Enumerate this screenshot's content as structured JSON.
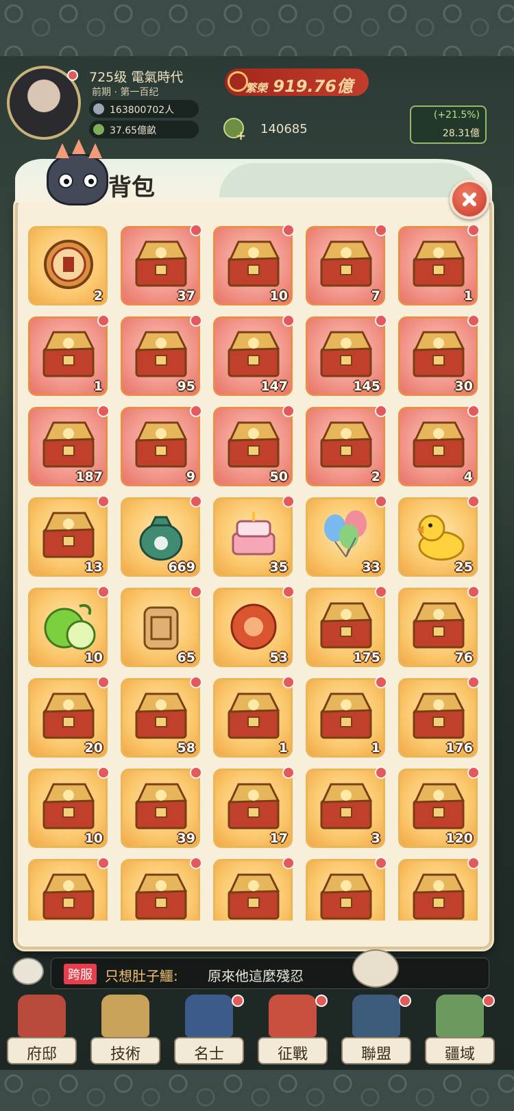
{
  "header": {
    "level": "725级",
    "era": "電氣時代",
    "period": "前期 · 第一百纪",
    "population": "163800702人",
    "land": "37.65億畝",
    "prosperity_label": "繁榮",
    "prosperity_value": "919.76億",
    "gold": "140685",
    "growth_pct": "(+21.5%)",
    "growth_amount": "28.31億"
  },
  "bag": {
    "title": "背包",
    "close_icon": "close-icon",
    "items": [
      {
        "qty": "2",
        "bg": "gold",
        "kind": "coin-token",
        "dot": false
      },
      {
        "qty": "37",
        "bg": "red",
        "kind": "chest",
        "dot": true
      },
      {
        "qty": "10",
        "bg": "red",
        "kind": "chest",
        "dot": true
      },
      {
        "qty": "7",
        "bg": "red",
        "kind": "chest",
        "dot": true
      },
      {
        "qty": "1",
        "bg": "red",
        "kind": "chest",
        "dot": true
      },
      {
        "qty": "1",
        "bg": "red",
        "kind": "chest",
        "dot": true
      },
      {
        "qty": "95",
        "bg": "red",
        "kind": "chest",
        "dot": true
      },
      {
        "qty": "147",
        "bg": "red",
        "kind": "chest",
        "dot": true
      },
      {
        "qty": "145",
        "bg": "red",
        "kind": "chest",
        "dot": true
      },
      {
        "qty": "30",
        "bg": "red",
        "kind": "chest",
        "dot": true
      },
      {
        "qty": "187",
        "bg": "red",
        "kind": "chest",
        "dot": true
      },
      {
        "qty": "9",
        "bg": "red",
        "kind": "chest",
        "dot": true
      },
      {
        "qty": "50",
        "bg": "red",
        "kind": "chest",
        "dot": true
      },
      {
        "qty": "2",
        "bg": "red",
        "kind": "chest",
        "dot": true
      },
      {
        "qty": "4",
        "bg": "red",
        "kind": "chest",
        "dot": true
      },
      {
        "qty": "13",
        "bg": "gold",
        "kind": "chest",
        "dot": true
      },
      {
        "qty": "669",
        "bg": "gold",
        "kind": "pouch",
        "dot": true
      },
      {
        "qty": "35",
        "bg": "gold",
        "kind": "cake",
        "dot": true
      },
      {
        "qty": "33",
        "bg": "gold",
        "kind": "balloons",
        "dot": true
      },
      {
        "qty": "25",
        "bg": "gold",
        "kind": "duck",
        "dot": true
      },
      {
        "qty": "10",
        "bg": "gold",
        "kind": "lime",
        "dot": true
      },
      {
        "qty": "65",
        "bg": "gold",
        "kind": "plaque",
        "dot": true
      },
      {
        "qty": "53",
        "bg": "gold",
        "kind": "papercut",
        "dot": true
      },
      {
        "qty": "175",
        "bg": "gold",
        "kind": "chest",
        "dot": true
      },
      {
        "qty": "76",
        "bg": "gold",
        "kind": "chest",
        "dot": true
      },
      {
        "qty": "20",
        "bg": "gold",
        "kind": "chest",
        "dot": true
      },
      {
        "qty": "58",
        "bg": "gold",
        "kind": "chest",
        "dot": true
      },
      {
        "qty": "1",
        "bg": "gold",
        "kind": "chest",
        "dot": true
      },
      {
        "qty": "1",
        "bg": "gold",
        "kind": "chest",
        "dot": true
      },
      {
        "qty": "176",
        "bg": "gold",
        "kind": "chest",
        "dot": true
      },
      {
        "qty": "10",
        "bg": "gold",
        "kind": "chest",
        "dot": true
      },
      {
        "qty": "39",
        "bg": "gold",
        "kind": "chest",
        "dot": true
      },
      {
        "qty": "17",
        "bg": "gold",
        "kind": "chest",
        "dot": true
      },
      {
        "qty": "3",
        "bg": "gold",
        "kind": "chest",
        "dot": true
      },
      {
        "qty": "120",
        "bg": "gold",
        "kind": "chest",
        "dot": true
      },
      {
        "qty": "",
        "bg": "gold",
        "kind": "chest",
        "dot": true
      },
      {
        "qty": "",
        "bg": "gold",
        "kind": "chest",
        "dot": true
      },
      {
        "qty": "",
        "bg": "gold",
        "kind": "chest",
        "dot": true
      },
      {
        "qty": "",
        "bg": "gold",
        "kind": "chest",
        "dot": true
      },
      {
        "qty": "",
        "bg": "gold",
        "kind": "chest",
        "dot": true
      }
    ]
  },
  "chat": {
    "tag": "跨服",
    "sender": "只想肚子鱷:",
    "message": "原來他這麼殘忍"
  },
  "nav": [
    {
      "label": "府邸",
      "icon": "mansion-icon"
    },
    {
      "label": "技術",
      "icon": "technology-icon"
    },
    {
      "label": "名士",
      "icon": "scholar-icon"
    },
    {
      "label": "征戰",
      "icon": "battle-icon"
    },
    {
      "label": "聯盟",
      "icon": "alliance-icon"
    },
    {
      "label": "疆域",
      "icon": "territory-icon"
    }
  ],
  "colors": {
    "red_dot": "#e25a5a",
    "slot_red": "#f39a8f",
    "slot_gold": "#fbc76c"
  }
}
